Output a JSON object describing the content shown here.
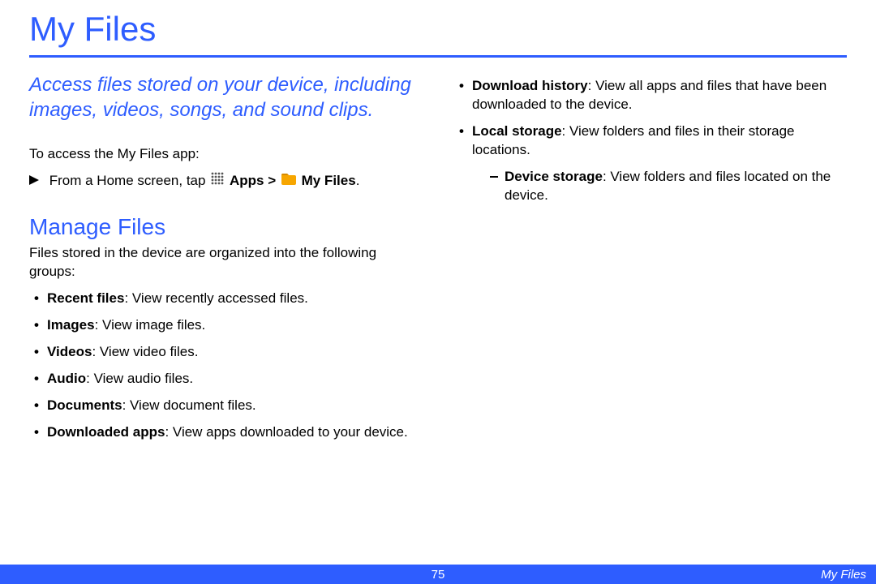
{
  "title": "My Files",
  "intro": "Access files stored on your device, including images, videos, songs, and sound clips.",
  "access_label": "To access the My Files app:",
  "instruction": {
    "prefix": "From a Home screen, tap",
    "apps_label": "Apps",
    "gt": ">",
    "myfiles_label": "My Files",
    "period": "."
  },
  "manage_heading": "Manage Files",
  "manage_intro": "Files stored in the device are organized into the following groups:",
  "groups_left": [
    {
      "term": "Recent files",
      "desc": ": View recently accessed files."
    },
    {
      "term": "Images",
      "desc": ": View image files."
    },
    {
      "term": "Videos",
      "desc": ": View video files."
    },
    {
      "term": "Audio",
      "desc": ": View audio files."
    },
    {
      "term": "Documents",
      "desc": ": View document files."
    },
    {
      "term": "Downloaded apps",
      "desc": ": View apps downloaded to your device."
    }
  ],
  "groups_right": [
    {
      "term": "Download history",
      "desc": ": View all apps and files that have been downloaded to the device."
    },
    {
      "term": "Local storage",
      "desc": ": View folders and files in their storage locations."
    }
  ],
  "sub_right": [
    {
      "term": "Device storage",
      "desc": ": View folders and files located on the device."
    }
  ],
  "footer": {
    "page": "75",
    "section": "My Files"
  }
}
